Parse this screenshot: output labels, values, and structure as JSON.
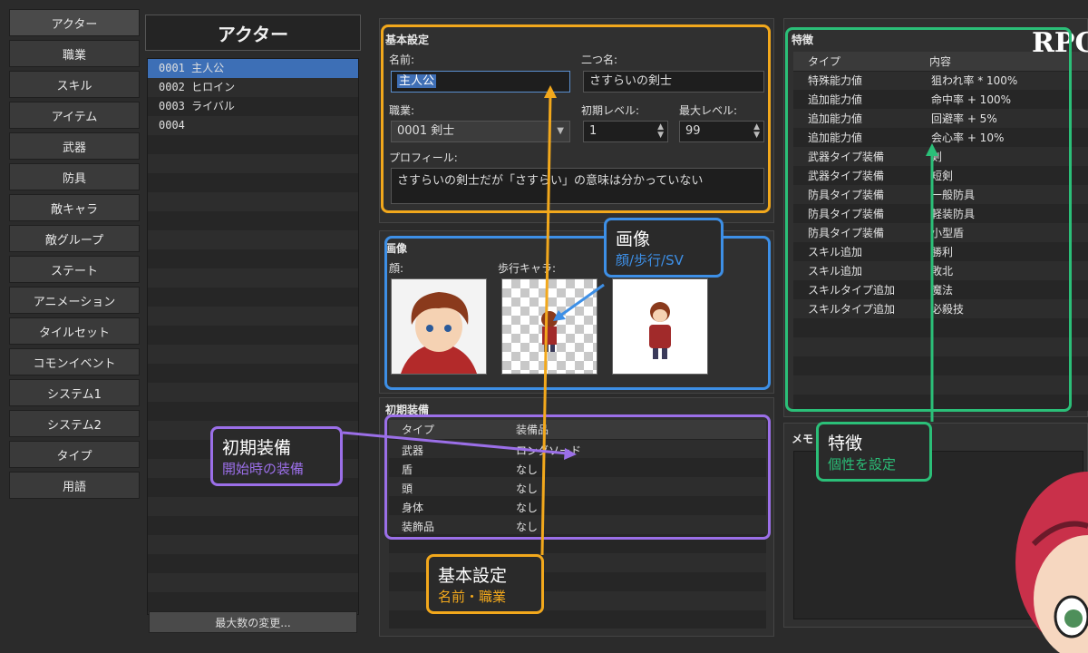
{
  "tabs": [
    "アクター",
    "職業",
    "スキル",
    "アイテム",
    "武器",
    "防具",
    "敵キャラ",
    "敵グループ",
    "ステート",
    "アニメーション",
    "タイルセット",
    "コモンイベント",
    "システム1",
    "システム2",
    "タイプ",
    "用語"
  ],
  "actor_list": {
    "title": "アクター",
    "rows": [
      "0001  主人公",
      "0002  ヒロイン",
      "0003  ライバル",
      "0004"
    ],
    "max_button": "最大数の変更..."
  },
  "basic": {
    "title": "基本設定",
    "name_label": "名前:",
    "name_value": "主人公",
    "nickname_label": "二つ名:",
    "nickname_value": "さすらいの剣士",
    "class_label": "職業:",
    "class_value": "0001 剣士",
    "initial_level_label": "初期レベル:",
    "initial_level_value": "1",
    "max_level_label": "最大レベル:",
    "max_level_value": "99",
    "profile_label": "プロフィール:",
    "profile_value": "さすらいの剣士だが「さすらい」の意味は分かっていない"
  },
  "images": {
    "title": "画像",
    "face_label": "顔:",
    "walk_label": "歩行キャラ:"
  },
  "equipment": {
    "title": "初期装備",
    "headers": [
      "タイプ",
      "装備品"
    ],
    "rows": [
      [
        "武器",
        "ロングソード"
      ],
      [
        "盾",
        "なし"
      ],
      [
        "頭",
        "なし"
      ],
      [
        "身体",
        "なし"
      ],
      [
        "装飾品",
        "なし"
      ]
    ]
  },
  "traits": {
    "title": "特徴",
    "headers": [
      "タイプ",
      "内容"
    ],
    "rows": [
      [
        "特殊能力値",
        "狙われ率 * 100%"
      ],
      [
        "追加能力値",
        "命中率 + 100%"
      ],
      [
        "追加能力値",
        "回避率 + 5%"
      ],
      [
        "追加能力値",
        "会心率 + 10%"
      ],
      [
        "武器タイプ装備",
        "剣"
      ],
      [
        "武器タイプ装備",
        "短剣"
      ],
      [
        "防具タイプ装備",
        "一般防具"
      ],
      [
        "防具タイプ装備",
        "軽装防具"
      ],
      [
        "防具タイプ装備",
        "小型盾"
      ],
      [
        "スキル追加",
        "勝利"
      ],
      [
        "スキル追加",
        "敗北"
      ],
      [
        "スキルタイプ追加",
        "魔法"
      ],
      [
        "スキルタイプ追加",
        "必殺技"
      ]
    ]
  },
  "memo": {
    "title": "メモ"
  },
  "logo": "RPG",
  "callouts": {
    "image": {
      "title": "画像",
      "sub": "顔/歩行/SV",
      "color": "#3d8fe6"
    },
    "equip": {
      "title": "初期装備",
      "sub": "開始時の装備",
      "color": "#9b6fe8"
    },
    "basic": {
      "title": "基本設定",
      "sub": "名前・職業",
      "color": "#f2a81c"
    },
    "traits": {
      "title": "特徴",
      "sub": "個性を設定",
      "color": "#2bbf78"
    }
  }
}
